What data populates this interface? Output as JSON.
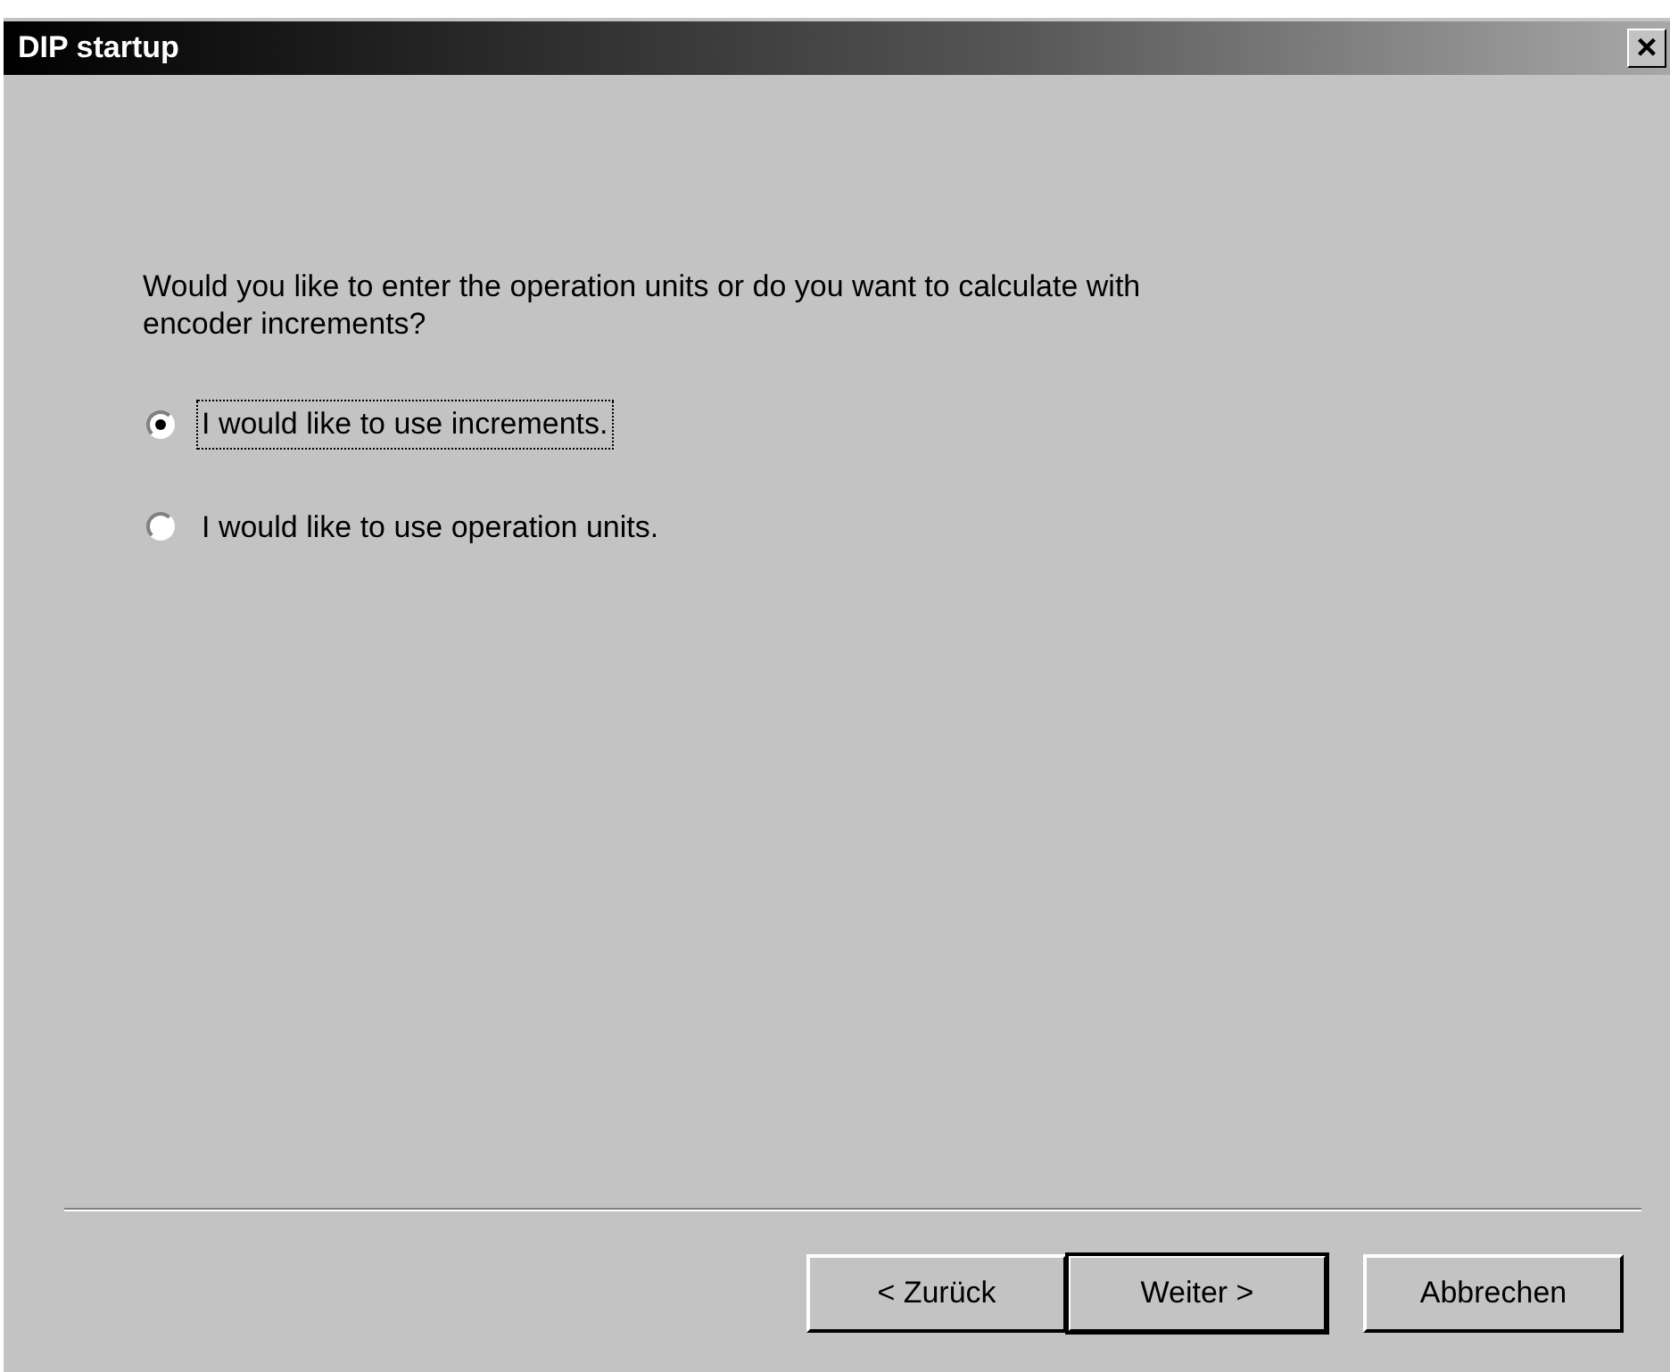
{
  "window": {
    "title": "DIP startup",
    "close_glyph": "×"
  },
  "question": "Would you like to enter the operation units or do you want to calculate with encoder increments?",
  "options": [
    {
      "label": "I would like to use increments.",
      "selected": true,
      "focused": true
    },
    {
      "label": "I would like to use operation units.",
      "selected": false,
      "focused": false
    }
  ],
  "buttons": [
    {
      "label": "< Zurück",
      "default": false
    },
    {
      "label": "Weiter >",
      "default": true
    },
    {
      "label": "Abbrechen",
      "default": false
    }
  ]
}
